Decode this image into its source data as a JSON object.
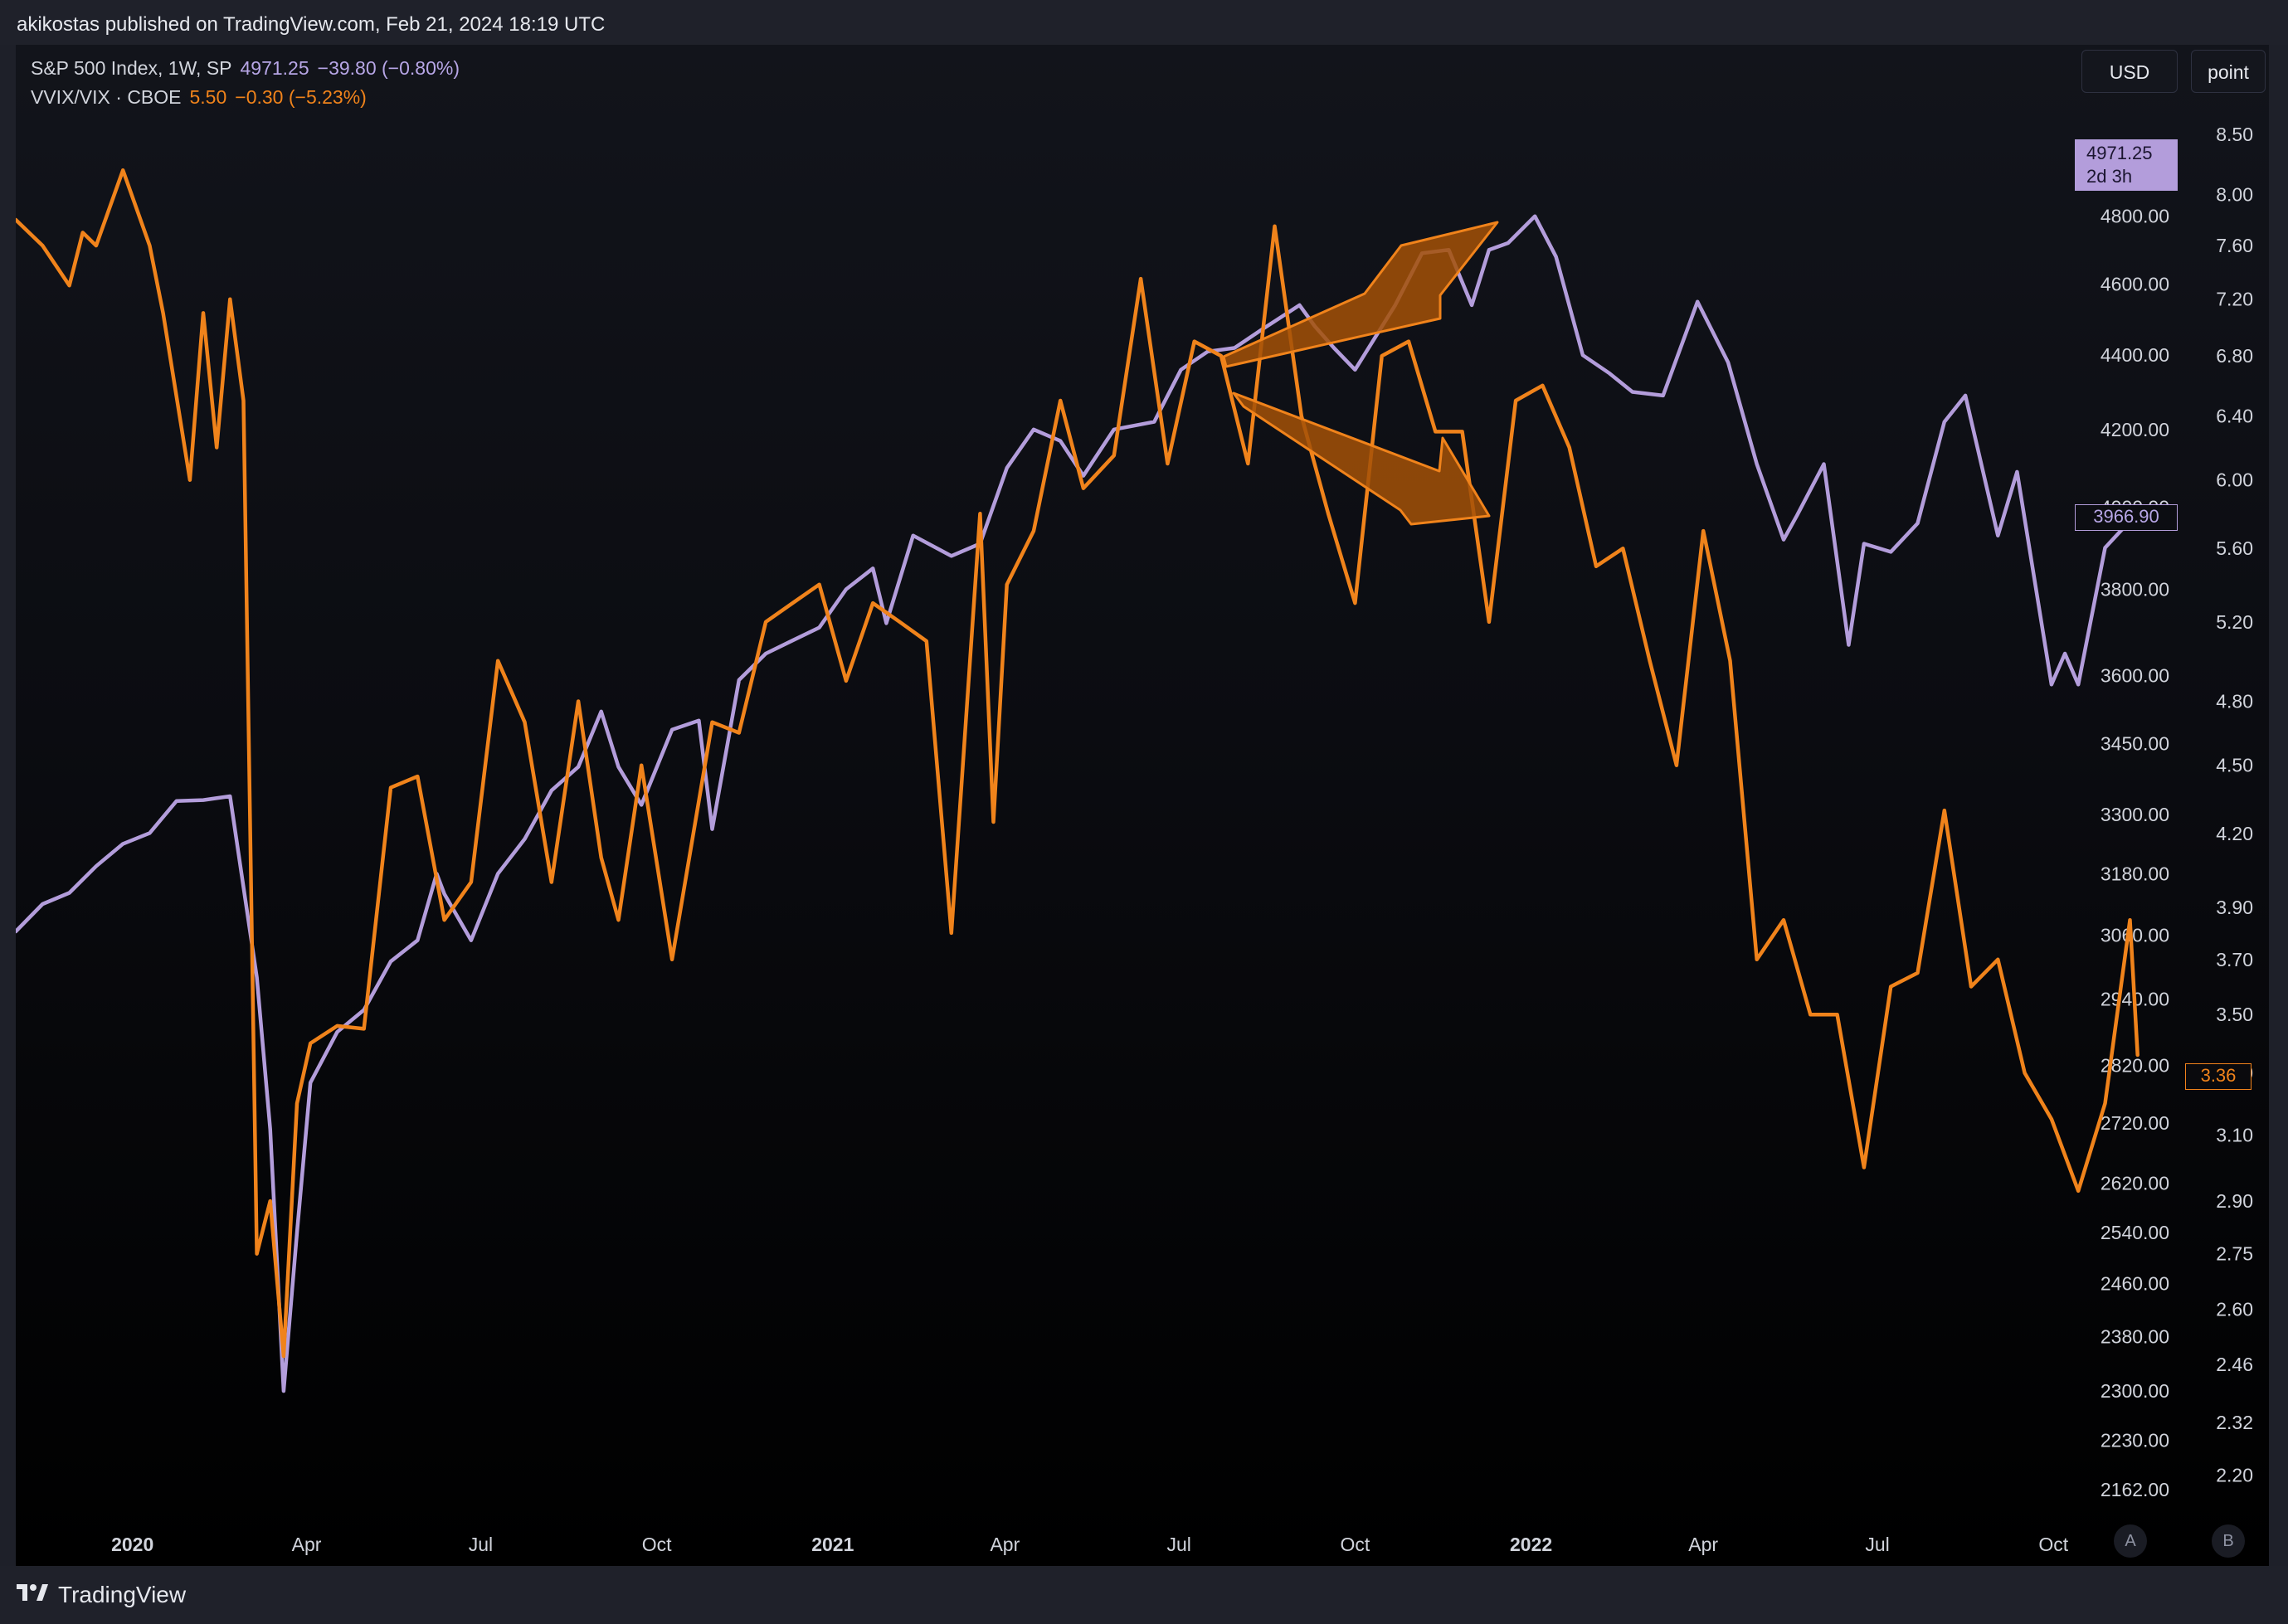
{
  "header": {
    "publish_text": "akikostas published on TradingView.com, Feb 21, 2024 18:19 UTC"
  },
  "legend": {
    "sp500": {
      "name": "S&P 500 Index, 1W, SP",
      "value": "4971.25",
      "change": "−39.80 (−0.80%)"
    },
    "vvix": {
      "name": "VVIX/VIX · CBOE",
      "value": "5.50",
      "change": "−0.30 (−5.23%)"
    }
  },
  "buttons": {
    "currency": "USD",
    "mode": "point",
    "a": "A",
    "b": "B"
  },
  "price_labels": {
    "sp500_last": "4971.25",
    "sp500_countdown": "2d 3h",
    "sp500_marker": "3966.90",
    "vvix_marker": "3.36"
  },
  "brand": {
    "name": "TradingView"
  },
  "colors": {
    "sp500": "#b39ddb",
    "vvix": "#f0831b",
    "annotation_fill": "#a35107"
  },
  "chart_data": {
    "type": "line",
    "x_axis": {
      "labels": [
        "2020",
        "Apr",
        "Jul",
        "Oct",
        "2021",
        "Apr",
        "Jul",
        "Oct",
        "2022",
        "Apr",
        "Jul",
        "Oct"
      ],
      "bold": [
        true,
        false,
        false,
        false,
        true,
        false,
        false,
        false,
        true,
        false,
        false,
        false
      ],
      "label_dates": [
        "2020-01-01",
        "2020-04-01",
        "2020-07-01",
        "2020-10-01",
        "2021-01-01",
        "2021-04-01",
        "2021-07-01",
        "2021-10-01",
        "2022-01-01",
        "2022-04-01",
        "2022-07-01",
        "2022-10-01"
      ],
      "range": [
        "2019-11-01",
        "2022-11-15"
      ]
    },
    "left_axis": {
      "scale": "log",
      "range": [
        2120,
        5180
      ],
      "ticks": [
        "4800.00",
        "4600.00",
        "4400.00",
        "4200.00",
        "4000.00",
        "3800.00",
        "3600.00",
        "3450.00",
        "3300.00",
        "3180.00",
        "3060.00",
        "2940.00",
        "2820.00",
        "2720.00",
        "2620.00",
        "2540.00",
        "2460.00",
        "2380.00",
        "2300.00",
        "2230.00",
        "2162.00"
      ]
    },
    "right_axis": {
      "scale": "log",
      "range": [
        2.1,
        8.85
      ],
      "ticks": [
        "8.50",
        "8.00",
        "7.60",
        "7.20",
        "6.80",
        "6.40",
        "6.00",
        "5.60",
        "5.20",
        "4.80",
        "4.50",
        "4.20",
        "3.90",
        "3.70",
        "3.50",
        "3.30",
        "3.10",
        "2.90",
        "2.75",
        "2.60",
        "2.46",
        "2.32",
        "2.20"
      ]
    },
    "series": [
      {
        "axis": "left",
        "x": [
          "2019-11-01",
          "2019-11-15",
          "2019-11-29",
          "2019-12-13",
          "2019-12-27",
          "2020-01-10",
          "2020-01-24",
          "2020-02-07",
          "2020-02-21",
          "2020-03-06",
          "2020-03-13",
          "2020-03-20",
          "2020-03-27",
          "2020-04-03",
          "2020-04-17",
          "2020-05-01",
          "2020-05-15",
          "2020-05-29",
          "2020-06-08",
          "2020-06-12",
          "2020-06-26",
          "2020-07-10",
          "2020-07-24",
          "2020-08-07",
          "2020-08-21",
          "2020-09-02",
          "2020-09-11",
          "2020-09-23",
          "2020-10-09",
          "2020-10-23",
          "2020-10-30",
          "2020-11-13",
          "2020-11-27",
          "2020-12-11",
          "2020-12-25",
          "2021-01-08",
          "2021-01-22",
          "2021-01-29",
          "2021-02-12",
          "2021-03-04",
          "2021-03-19",
          "2021-04-02",
          "2021-04-16",
          "2021-04-30",
          "2021-05-12",
          "2021-05-28",
          "2021-06-18",
          "2021-07-02",
          "2021-07-16",
          "2021-07-30",
          "2021-08-13",
          "2021-09-02",
          "2021-09-10",
          "2021-09-20",
          "2021-10-01",
          "2021-10-22",
          "2021-11-05",
          "2021-11-19",
          "2021-12-01",
          "2021-12-10",
          "2021-12-20",
          "2022-01-03",
          "2022-01-14",
          "2022-01-28",
          "2022-02-11",
          "2022-02-23",
          "2022-03-11",
          "2022-03-29",
          "2022-04-14",
          "2022-04-29",
          "2022-05-13",
          "2022-05-20",
          "2022-06-03",
          "2022-06-16",
          "2022-06-24",
          "2022-07-08",
          "2022-07-22",
          "2022-08-05",
          "2022-08-16",
          "2022-09-02",
          "2022-09-12",
          "2022-09-30",
          "2022-10-07",
          "2022-10-14",
          "2022-10-28",
          "2022-11-10"
        ],
        "y": [
          3067,
          3120,
          3142,
          3195,
          3240,
          3262,
          3328,
          3330,
          3338,
          2980,
          2710,
          2300,
          2540,
          2790,
          2880,
          2920,
          3010,
          3050,
          3180,
          3140,
          3050,
          3180,
          3250,
          3350,
          3400,
          3520,
          3400,
          3320,
          3480,
          3500,
          3270,
          3590,
          3650,
          3680,
          3710,
          3800,
          3850,
          3720,
          3930,
          3880,
          3910,
          4100,
          4200,
          4170,
          4080,
          4200,
          4220,
          4360,
          4410,
          4420,
          4470,
          4540,
          4480,
          4420,
          4360,
          4540,
          4690,
          4700,
          4540,
          4700,
          4720,
          4800,
          4680,
          4400,
          4350,
          4300,
          4290,
          4550,
          4380,
          4110,
          3920,
          3980,
          4110,
          3670,
          3910,
          3890,
          3960,
          4220,
          4290,
          3930,
          4090,
          3580,
          3650,
          3580,
          3900,
          3966
        ]
      },
      {
        "axis": "right",
        "x": [
          "2019-11-01",
          "2019-11-15",
          "2019-11-29",
          "2019-12-06",
          "2019-12-13",
          "2019-12-27",
          "2020-01-10",
          "2020-01-17",
          "2020-01-31",
          "2020-02-07",
          "2020-02-14",
          "2020-02-21",
          "2020-02-28",
          "2020-03-06",
          "2020-03-13",
          "2020-03-20",
          "2020-03-27",
          "2020-04-03",
          "2020-04-17",
          "2020-05-01",
          "2020-05-15",
          "2020-05-29",
          "2020-06-12",
          "2020-06-26",
          "2020-07-10",
          "2020-07-24",
          "2020-08-07",
          "2020-08-21",
          "2020-09-02",
          "2020-09-11",
          "2020-09-23",
          "2020-10-09",
          "2020-10-30",
          "2020-11-13",
          "2020-11-27",
          "2020-12-11",
          "2020-12-25",
          "2021-01-08",
          "2021-01-22",
          "2021-02-05",
          "2021-02-19",
          "2021-03-04",
          "2021-03-19",
          "2021-03-26",
          "2021-04-02",
          "2021-04-16",
          "2021-04-30",
          "2021-05-12",
          "2021-05-28",
          "2021-06-11",
          "2021-06-25",
          "2021-07-09",
          "2021-07-23",
          "2021-08-06",
          "2021-08-20",
          "2021-09-03",
          "2021-09-17",
          "2021-10-01",
          "2021-10-15",
          "2021-10-29",
          "2021-11-12",
          "2021-11-26",
          "2021-12-10",
          "2021-12-24",
          "2022-01-07",
          "2022-01-21",
          "2022-02-04",
          "2022-02-18",
          "2022-03-04",
          "2022-03-18",
          "2022-04-01",
          "2022-04-15",
          "2022-04-29",
          "2022-05-13",
          "2022-05-27",
          "2022-06-10",
          "2022-06-24",
          "2022-07-08",
          "2022-07-22",
          "2022-08-05",
          "2022-08-19",
          "2022-09-02",
          "2022-09-16",
          "2022-09-30",
          "2022-10-14",
          "2022-10-28",
          "2022-11-10",
          "2022-11-14"
        ],
        "y": [
          7.8,
          7.6,
          7.3,
          7.7,
          7.6,
          8.2,
          7.6,
          7.1,
          6.0,
          7.1,
          6.2,
          7.2,
          6.5,
          2.75,
          2.9,
          2.48,
          3.2,
          3.4,
          3.46,
          3.45,
          4.4,
          4.45,
          3.85,
          4.0,
          5.0,
          4.7,
          4.0,
          4.8,
          4.1,
          3.85,
          4.5,
          3.7,
          4.7,
          4.65,
          5.2,
          5.3,
          5.4,
          4.9,
          5.3,
          5.2,
          5.1,
          3.8,
          5.8,
          4.25,
          5.4,
          5.7,
          6.5,
          5.95,
          6.15,
          7.35,
          6.1,
          6.9,
          6.8,
          6.1,
          7.75,
          6.4,
          5.8,
          5.3,
          6.8,
          6.9,
          6.3,
          6.3,
          5.2,
          6.5,
          6.6,
          6.2,
          5.5,
          5.6,
          5.0,
          4.5,
          5.7,
          5.0,
          3.7,
          3.85,
          3.5,
          3.5,
          3.0,
          3.6,
          3.65,
          4.3,
          3.6,
          3.7,
          3.3,
          3.15,
          2.93,
          3.2,
          3.85,
          3.36
        ]
      }
    ]
  }
}
